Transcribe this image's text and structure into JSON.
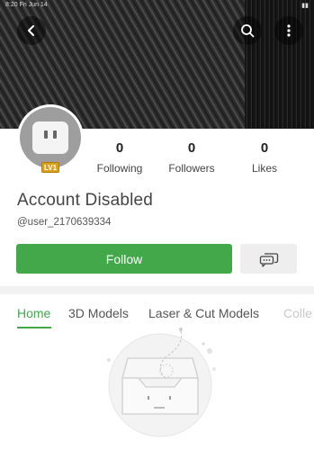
{
  "status_bar": {
    "time": "8:20",
    "date": "Fri Jun 14",
    "battery": "●"
  },
  "header": {
    "back_icon": "chevron-left-icon",
    "search_icon": "search-icon",
    "more_icon": "more-vertical-icon"
  },
  "profile": {
    "avatar_icon": "robot-avatar-icon",
    "level_badge": "LV1",
    "account_name": "Account Disabled",
    "username": "@user_2170639334"
  },
  "stats": [
    {
      "value": "0",
      "label": "Following"
    },
    {
      "value": "0",
      "label": "Followers"
    },
    {
      "value": "0",
      "label": "Likes"
    }
  ],
  "actions": {
    "follow_label": "Follow",
    "message_icon": "chat-bubbles-icon"
  },
  "tabs": [
    {
      "label": "Home",
      "active": true
    },
    {
      "label": "3D Models",
      "active": false
    },
    {
      "label": "Laser & Cut Models",
      "active": false
    },
    {
      "label": "Colle",
      "active": false
    }
  ],
  "empty_state": {
    "icon": "empty-inbox-icon"
  },
  "colors": {
    "accent": "#43a84a",
    "badge": "#d9a21b"
  }
}
